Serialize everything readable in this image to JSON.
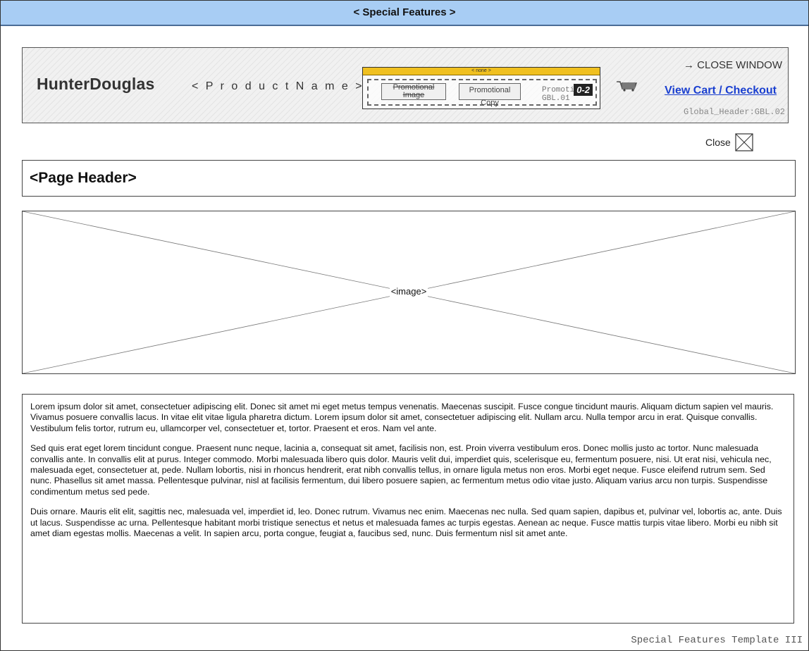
{
  "window": {
    "title": "< Special Features >"
  },
  "global_header": {
    "logo": "HunterDouglas",
    "product_name": "< P r o d u c t   N a m e >",
    "promo": {
      "bar_label": "< none >",
      "image_label": "Promotional Image",
      "copy_label": "Promotional Copy",
      "promotions_label": "Promotions: GBL.01",
      "badge": "0-2"
    },
    "cart_icon": "cart-icon",
    "close_window": "→  CLOSE WINDOW",
    "view_cart": "View Cart / Checkout",
    "label": "Global_Header:GBL.02"
  },
  "close": {
    "label": "Close",
    "icon": "close-x-icon"
  },
  "page_header": {
    "title": "<Page Header>"
  },
  "image": {
    "label": "<image>"
  },
  "body": {
    "paragraphs": [
      "Lorem ipsum dolor sit amet, consectetuer adipiscing elit. Donec sit amet mi eget metus tempus venenatis. Maecenas suscipit. Fusce congue tincidunt mauris. Aliquam dictum sapien vel mauris. Vivamus posuere convallis lacus. In vitae elit vitae ligula pharetra dictum. Lorem ipsum dolor sit amet, consectetuer adipiscing elit. Nullam arcu. Nulla tempor arcu in erat. Quisque convallis. Vestibulum felis tortor, rutrum eu, ullamcorper vel, consectetuer et, tortor. Praesent et eros. Nam vel ante.",
      "Sed quis erat eget lorem tincidunt congue. Praesent nunc neque, lacinia a, consequat sit amet, facilisis non, est. Proin viverra vestibulum eros. Donec mollis justo ac tortor. Nunc malesuada convallis ante. In convallis elit at purus. Integer commodo. Morbi malesuada libero quis dolor. Mauris velit dui, imperdiet quis, scelerisque eu, fermentum posuere, nisi. Ut erat nisi, vehicula nec, malesuada eget, consectetuer at, pede. Nullam lobortis, nisi in rhoncus hendrerit, erat nibh convallis tellus, in ornare ligula metus non eros. Morbi eget neque. Fusce eleifend rutrum sem. Sed nunc. Phasellus sit amet massa. Pellentesque pulvinar, nisl at facilisis fermentum, dui libero posuere sapien, ac fermentum metus odio vitae justo. Aliquam varius arcu non turpis. Suspendisse condimentum metus sed pede.",
      "Duis ornare. Mauris elit elit, sagittis nec, malesuada vel, imperdiet id, leo. Donec rutrum. Vivamus nec enim. Maecenas nec nulla. Sed quam sapien, dapibus et, pulvinar vel, lobortis ac, ante. Duis ut lacus. Suspendisse ac urna. Pellentesque habitant morbi tristique senectus et netus et malesuada fames ac turpis egestas. Aenean ac neque. Fusce mattis turpis vitae libero. Morbi eu nibh sit amet diam egestas mollis. Maecenas a velit. In sapien arcu, porta congue, feugiat a, faucibus sed, nunc. Duis fermentum nisl sit amet ante."
    ]
  },
  "footer": {
    "label": "Special Features Template III"
  },
  "colors": {
    "titlebar": "#a8cdf4",
    "promo_bar": "#f0c020",
    "link": "#1a3fd0"
  }
}
